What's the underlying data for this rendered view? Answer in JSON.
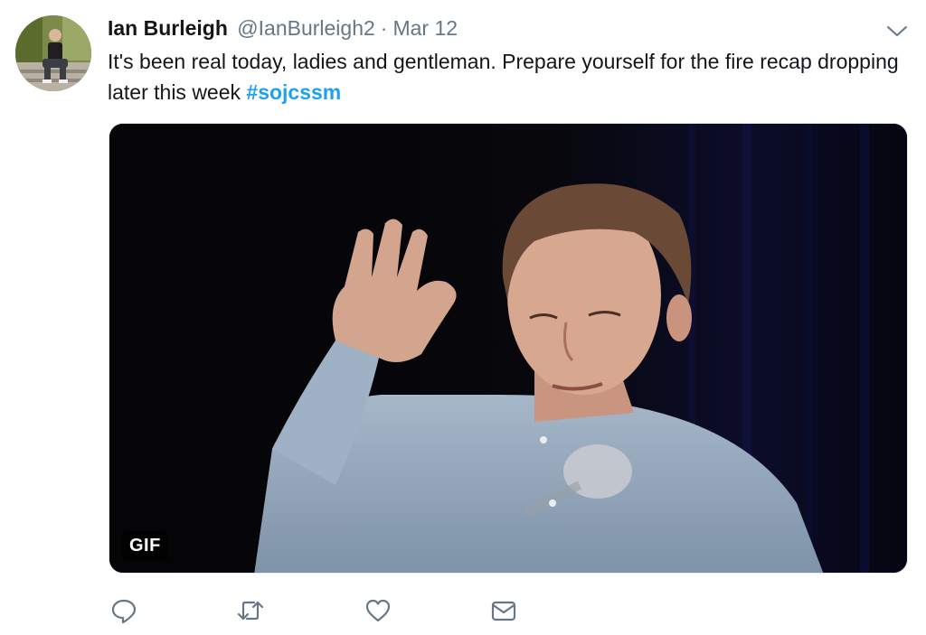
{
  "tweet": {
    "author_name": "Ian Burleigh",
    "author_handle": "@IanBurleigh2",
    "separator": "·",
    "date": "Mar 12",
    "text": "It's been real today, ladies and gentleman. Prepare yourself for the fire recap dropping later this week",
    "hashtag": "#sojcssm",
    "media_badge": "GIF"
  },
  "colors": {
    "text": "#14171a",
    "secondary": "#657786",
    "link": "#1da1f2",
    "icon": "#657786"
  },
  "icons": {
    "more": "chevron-down-icon",
    "reply": "reply-icon",
    "retweet": "retweet-icon",
    "like": "heart-icon",
    "dm": "envelope-icon"
  }
}
